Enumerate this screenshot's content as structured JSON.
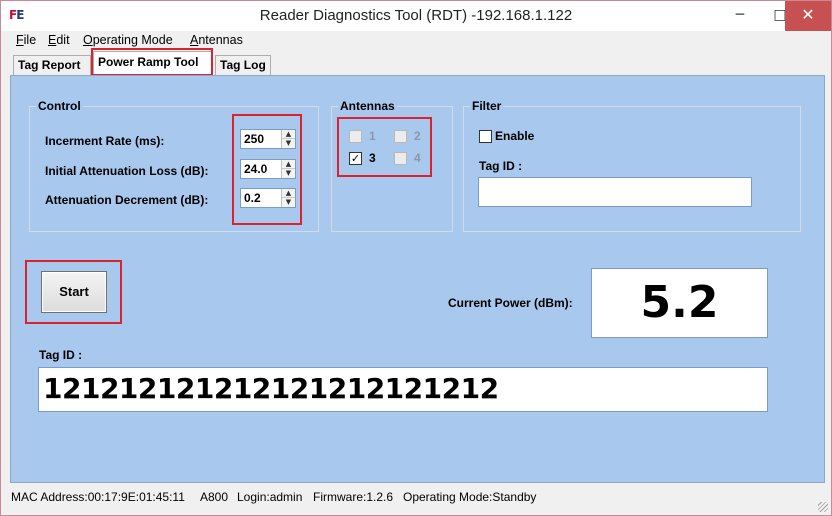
{
  "window": {
    "title": "Reader Diagnostics Tool (RDT) -192.168.1.122",
    "logo_text_a": "F",
    "logo_text_b": "E",
    "min_label": "─",
    "max_label": "□",
    "close_label": "✕"
  },
  "menu": {
    "items": [
      "File",
      "Edit",
      "Operating Mode",
      "Antennas"
    ]
  },
  "tabs": [
    {
      "label": "Tag Report",
      "active": false
    },
    {
      "label": "Power Ramp Tool",
      "active": true
    },
    {
      "label": "Tag Log",
      "active": false
    }
  ],
  "control": {
    "title": "Control",
    "increment_rate_label": "Incerment Rate (ms):",
    "increment_rate_value": "250",
    "initial_attenuation_label": "Initial Attenuation Loss (dB):",
    "initial_attenuation_value": "24.0",
    "attenuation_decrement_label": "Attenuation Decrement (dB):",
    "attenuation_decrement_value": "0.2",
    "spin_up": "▲",
    "spin_down": "▼"
  },
  "antennas": {
    "title": "Antennas",
    "items": [
      {
        "label": "1",
        "checked": false,
        "enabled": false
      },
      {
        "label": "2",
        "checked": false,
        "enabled": false
      },
      {
        "label": "3",
        "checked": true,
        "enabled": true
      },
      {
        "label": "4",
        "checked": false,
        "enabled": false
      }
    ],
    "check_mark": "✓"
  },
  "filter": {
    "title": "Filter",
    "enable_label": "Enable",
    "enable_checked": false,
    "tag_id_label": "Tag ID :",
    "tag_id_value": ""
  },
  "start_button": {
    "label": "Start"
  },
  "current_power": {
    "label": "Current Power (dBm):",
    "value": "5.2"
  },
  "tag_id": {
    "label": "Tag ID :",
    "value": "121212121212121212121212"
  },
  "status": {
    "mac": "MAC Address:00:17:9E:01:45:11",
    "model": "A800",
    "login": "Login:admin",
    "firmware": "Firmware:1.2.6",
    "mode": "Operating Mode:Standby"
  },
  "colors": {
    "panel_bg": "#a9c8ee",
    "highlight_box": "#d9232e",
    "close_button": "#c75050"
  }
}
